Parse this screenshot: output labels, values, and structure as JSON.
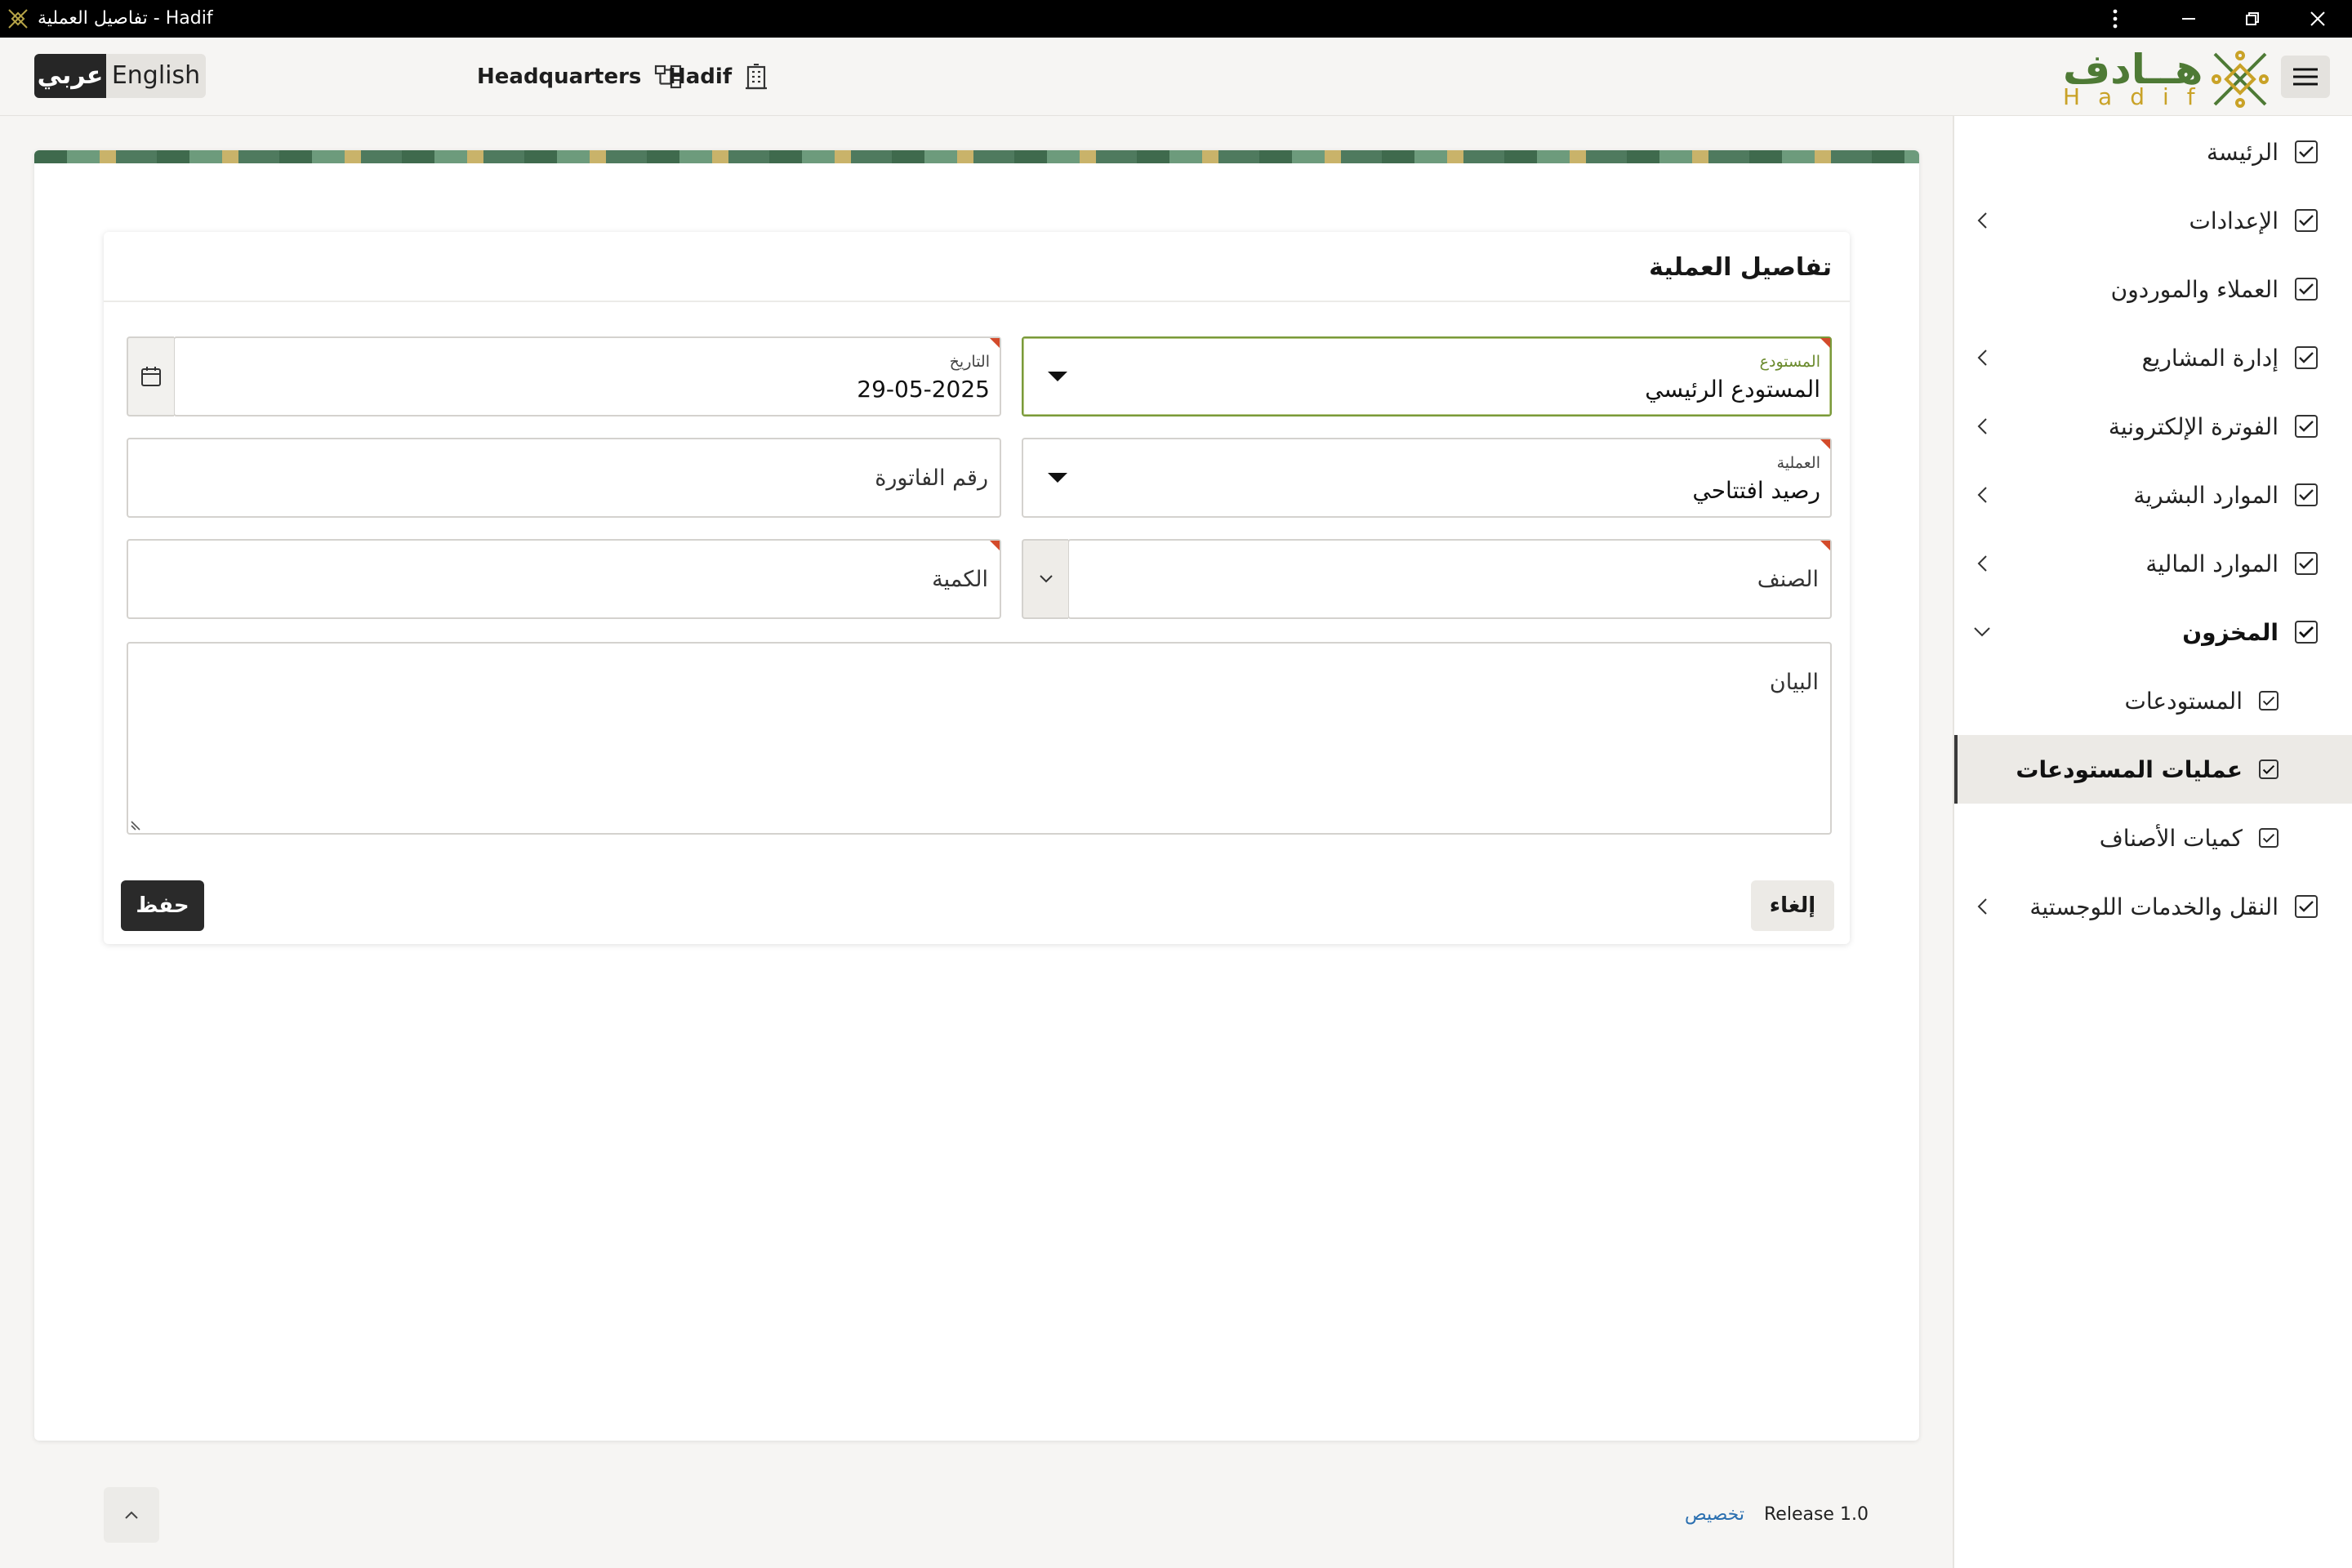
{
  "window": {
    "title": "تفاصيل العملية - Hadif",
    "icons": [
      "app-logo-icon",
      "more-vert-icon",
      "minimize-icon",
      "restore-icon",
      "close-icon"
    ]
  },
  "header": {
    "lang_ar": "عربي",
    "lang_en": "English",
    "headquarters": "Headquarters",
    "company": "Hadif",
    "brand_ar": "هــادف",
    "brand_en": "Hadif"
  },
  "sidebar": {
    "items": [
      {
        "label": "الرئيسة"
      },
      {
        "label": "الإعدادات"
      },
      {
        "label": "العملاء والموردون"
      },
      {
        "label": "إدارة المشاريع"
      },
      {
        "label": "الفوترة الإلكترونية"
      },
      {
        "label": "الموارد البشرية"
      },
      {
        "label": "الموارد المالية"
      },
      {
        "label": "المخزون"
      },
      {
        "label": "المستودعات"
      },
      {
        "label": "عمليات المستودعات"
      },
      {
        "label": "كميات الأصناف"
      },
      {
        "label": "النقل والخدمات اللوجستية"
      }
    ]
  },
  "form": {
    "title": "تفاصيل العملية",
    "warehouse": {
      "label": "المستودع",
      "value": "المستودع الرئيسي"
    },
    "date": {
      "label": "التاريخ",
      "value": "29-05-2025"
    },
    "operation": {
      "label": "العملية",
      "value": "رصيد افتتاحي"
    },
    "invoice_no": {
      "placeholder": "رقم الفاتورة"
    },
    "item": {
      "placeholder": "الصنف"
    },
    "quantity": {
      "placeholder": "الكمية"
    },
    "description": {
      "placeholder": "البيان"
    },
    "save_label": "حفظ",
    "cancel_label": "إلغاء"
  },
  "footer": {
    "customize": "تخصيص",
    "release": "Release 1.0"
  },
  "colors": {
    "accent_green": "#6a8a2c",
    "brand_gold": "#c9a227",
    "required_marker": "#d34a2a",
    "dark_button": "#2a2a2a"
  }
}
